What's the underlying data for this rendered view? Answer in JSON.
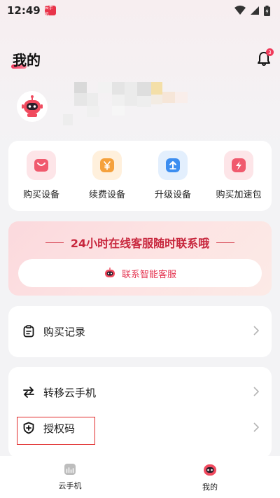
{
  "status_bar": {
    "time": "12:49",
    "app_badge": "云手机"
  },
  "header": {
    "title": "我的",
    "notification_count": "3"
  },
  "quick_actions": [
    {
      "label": "购买设备",
      "icon": "shopping-bag-icon",
      "color": "#f05a6e",
      "bg": "#fde5e8"
    },
    {
      "label": "续费设备",
      "icon": "yen-icon",
      "color": "#f5a13c",
      "bg": "#fff0dc"
    },
    {
      "label": "升级设备",
      "icon": "upgrade-icon",
      "color": "#3d8ef0",
      "bg": "#e3effd"
    },
    {
      "label": "购买加速包",
      "icon": "lightning-icon",
      "color": "#f05a6e",
      "bg": "#fde5e8"
    }
  ],
  "service": {
    "title": "24小时在线客服随时联系哦",
    "button_label": "联系智能客服"
  },
  "menu": {
    "purchase_records": "购买记录",
    "transfer_phone": "转移云手机",
    "auth_code": "授权码"
  },
  "bottom_nav": [
    {
      "label": "云手机",
      "icon": "cloud-phone-icon"
    },
    {
      "label": "我的",
      "icon": "robot-icon"
    }
  ],
  "colors": {
    "accent": "#f0365a",
    "highlight_border": "#e02a2a"
  }
}
